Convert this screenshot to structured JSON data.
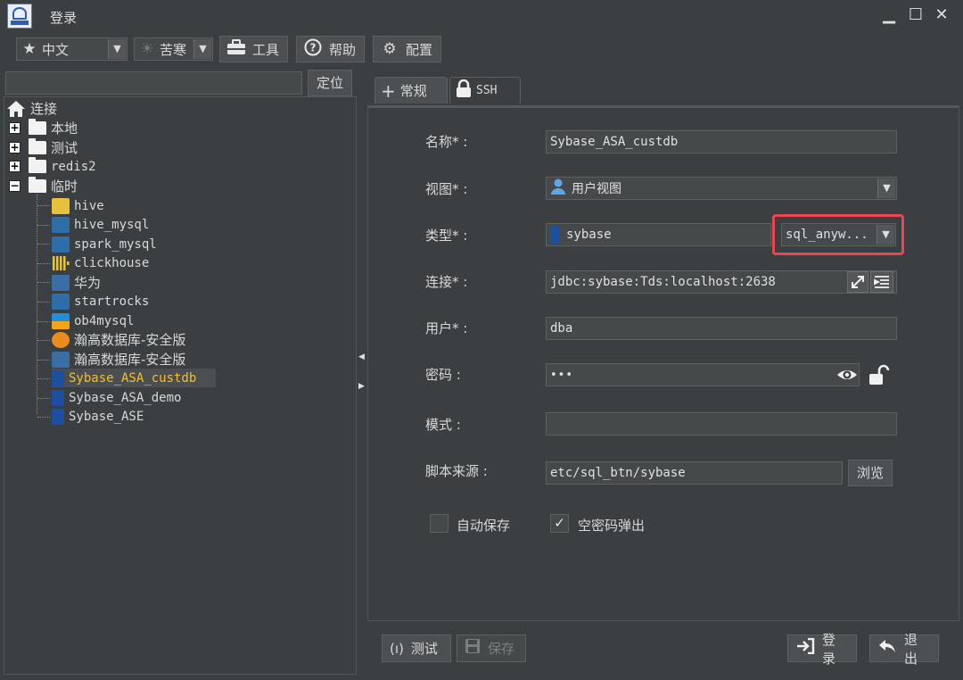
{
  "window": {
    "title": "登录",
    "minimize_glyph": "▁",
    "maximize_glyph": "☐",
    "close_glyph": "✕"
  },
  "toolbar": {
    "language": {
      "value": "中文",
      "icon": "star-icon"
    },
    "theme": {
      "value": "苦寒",
      "icon": "sun-icon"
    },
    "tools_label": "工具",
    "help_label": "帮助",
    "config_label": "配置"
  },
  "sidebar": {
    "search_placeholder": "",
    "locate_label": "定位",
    "root_label": "连接",
    "folders": [
      {
        "label": "本地",
        "expanded": false
      },
      {
        "label": "测试",
        "expanded": false
      },
      {
        "label": "redis2",
        "expanded": false
      },
      {
        "label": "临时",
        "expanded": true
      }
    ],
    "connections": [
      {
        "label": "hive",
        "icon": "hive-icon",
        "color": "#e6c23a"
      },
      {
        "label": "hive_mysql",
        "icon": "mysql-icon",
        "color": "#2e6ea8"
      },
      {
        "label": "spark_mysql",
        "icon": "mysql-icon",
        "color": "#2e6ea8"
      },
      {
        "label": "clickhouse",
        "icon": "clickhouse-icon",
        "color": "#f2c811"
      },
      {
        "label": "华为",
        "icon": "postgres-icon",
        "color": "#3a6fa6"
      },
      {
        "label": "startrocks",
        "icon": "mysql-icon",
        "color": "#2e6ea8"
      },
      {
        "label": "ob4mysql",
        "icon": "oceanbase-icon",
        "color": "#1f8fdc"
      },
      {
        "label": "瀚高数据库-安全版",
        "icon": "highgo-icon",
        "color": "#e98b1e"
      },
      {
        "label": "瀚高数据库-安全版",
        "icon": "postgres-icon",
        "color": "#3a6fa6"
      },
      {
        "label": "Sybase_ASA_custdb",
        "icon": "sybase-icon",
        "color": "#1c4fa0",
        "selected": true
      },
      {
        "label": "Sybase_ASA_demo",
        "icon": "sybase-icon",
        "color": "#1c4fa0"
      },
      {
        "label": "Sybase_ASE",
        "icon": "sybase-icon",
        "color": "#1c4fa0"
      }
    ]
  },
  "tabs": [
    {
      "label": "常规",
      "icon": "plus-icon",
      "active": true
    },
    {
      "label": "SSH",
      "icon": "lock-icon",
      "active": false
    }
  ],
  "form": {
    "name_label": "名称*  :",
    "name_value": "Sybase_ASA_custdb",
    "view_label": "视图*  :",
    "view_value": "用户视图",
    "type_label": "类型*  :",
    "type_value": "sybase",
    "driver_value": "sql_anyw...",
    "conn_label": "连接*  :",
    "conn_value": "jdbc:sybase:Tds:localhost:2638",
    "user_label": "用户*  :",
    "user_value": "dba",
    "password_label": "密码  :",
    "password_value": "•••",
    "schema_label": "模式  :",
    "schema_value": "",
    "script_label": "脚本来源  :",
    "script_value": "etc/sql_btn/sybase",
    "browse_label": "浏览",
    "autosave_label": "自动保存",
    "autosave_checked": false,
    "empty_pwd_label": "空密码弹出",
    "empty_pwd_checked": true,
    "check_glyph": "✓"
  },
  "footer": {
    "test_label": "测试",
    "save_label": "保存",
    "login_label": "登录",
    "exit_label": "退出"
  },
  "colors": {
    "background": "#3c3f41",
    "selected_text": "#f0c030",
    "highlight_border": "#e8474f"
  }
}
